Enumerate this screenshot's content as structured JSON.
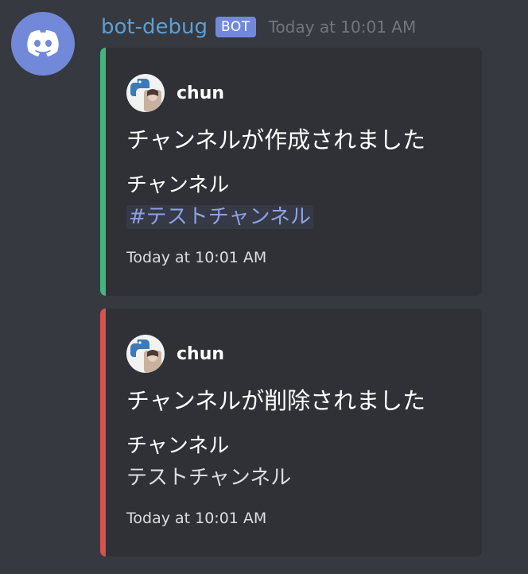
{
  "message": {
    "author": "bot-debug",
    "tag": "BOT",
    "timestamp": "Today at 10:01 AM",
    "avatar_icon": "discord-logo-icon",
    "avatar_color": "#7289da"
  },
  "embeds": [
    {
      "color": "#43b581",
      "author": "chun",
      "title": "チャンネルが作成されました",
      "field_name": "チャンネル",
      "field_value": "#テストチャンネル",
      "footer": "Today at 10:01 AM"
    },
    {
      "color": "#d9514e",
      "author": "chun",
      "title": "チャンネルが削除されました",
      "field_name": "チャンネル",
      "field_value": "テストチャンネル",
      "footer": "Today at 10:01 AM"
    }
  ]
}
